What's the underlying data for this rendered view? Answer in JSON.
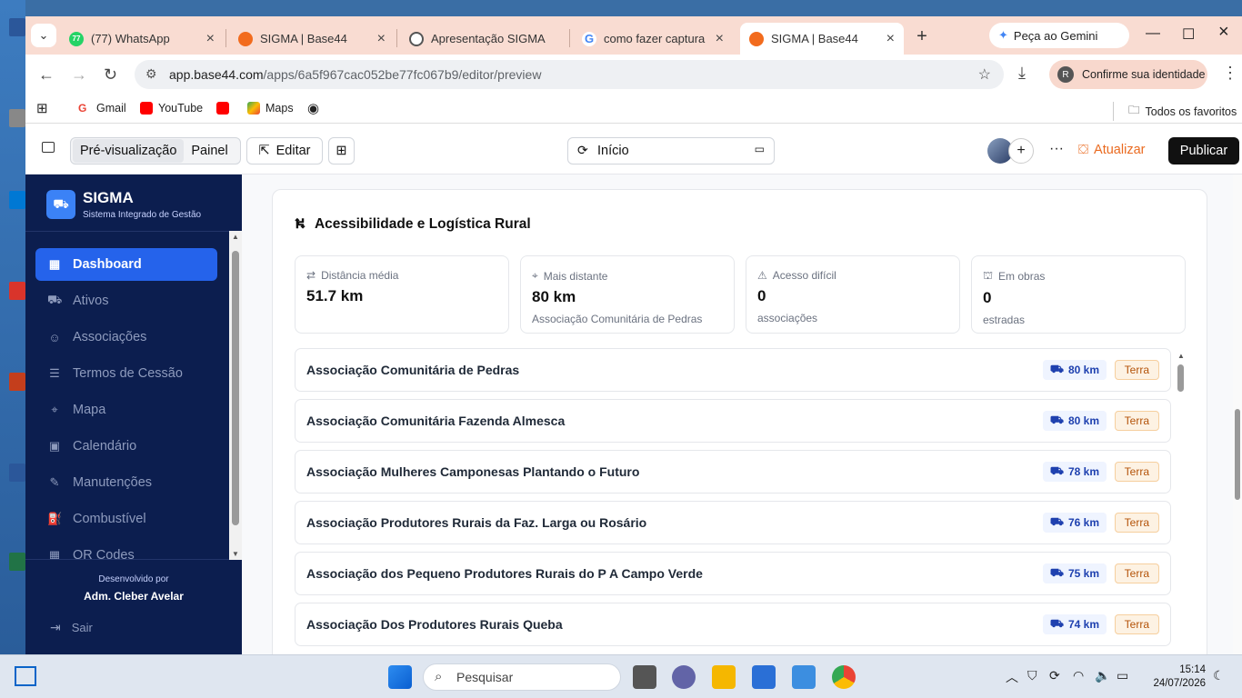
{
  "browser": {
    "tabs": [
      {
        "title": "(77) WhatsApp",
        "fav_color": "#25d366",
        "fav_text": "77"
      },
      {
        "title": "SIGMA | Base44",
        "fav_color": "#f26b1d",
        "fav_text": ""
      },
      {
        "title": "Apresentação SIGMA",
        "fav_color": "#555555",
        "fav_text": ""
      },
      {
        "title": "como fazer captura de",
        "fav_color": "#4285f4",
        "fav_text": "G"
      },
      {
        "title": "SIGMA | Base44",
        "fav_color": "#f26b1d",
        "fav_text": ""
      }
    ],
    "gemini_label": "Peça ao Gemini",
    "url_host": "app.base44.com",
    "url_path": "/apps/6a5f967cac052be77fc067b9/editor/preview",
    "confirm_label": "Confirme sua identidade",
    "bookmarks": [
      "Gmail",
      "YouTube",
      "Maps"
    ],
    "all_favorites": "Todos os favoritos"
  },
  "editor": {
    "preview_label": "Pré-visualização",
    "panel_label": "Painel",
    "edit_label": "Editar",
    "route_label": "Início",
    "update_label": "Atualizar",
    "publish_label": "Publicar"
  },
  "sidebar": {
    "app_name": "SIGMA",
    "app_sub": "Sistema Integrado de Gestão",
    "items": [
      {
        "label": "Dashboard",
        "icon": "▦"
      },
      {
        "label": "Ativos",
        "icon": "⛟"
      },
      {
        "label": "Associações",
        "icon": "☺"
      },
      {
        "label": "Termos de Cessão",
        "icon": "☰"
      },
      {
        "label": "Mapa",
        "icon": "⌖"
      },
      {
        "label": "Calendário",
        "icon": "▣"
      },
      {
        "label": "Manutenções",
        "icon": "✎"
      },
      {
        "label": "Combustível",
        "icon": "⛽"
      },
      {
        "label": "QR Codes",
        "icon": "▦"
      }
    ],
    "dev_label": "Desenvolvido por",
    "dev_name": "Adm. Cleber Avelar",
    "logout": "Sair"
  },
  "section": {
    "title": "Acessibilidade e Logística Rural",
    "stats": [
      {
        "label": "Distância média",
        "value": "51.7 km",
        "sub": ""
      },
      {
        "label": "Mais distante",
        "value": "80 km",
        "sub": "Associação Comunitária de Pedras"
      },
      {
        "label": "Acesso difícil",
        "value": "0",
        "sub": "associações"
      },
      {
        "label": "Em obras",
        "value": "0",
        "sub": "estradas"
      }
    ],
    "rows": [
      {
        "name": "Associação Comunitária de Pedras",
        "km": "80 km",
        "tag": "Terra"
      },
      {
        "name": "Associação Comunitária Fazenda Almesca",
        "km": "80 km",
        "tag": "Terra"
      },
      {
        "name": "Associação Mulheres Camponesas Plantando o Futuro",
        "km": "78 km",
        "tag": "Terra"
      },
      {
        "name": "Associação Produtores Rurais da Faz. Larga ou Rosário",
        "km": "76 km",
        "tag": "Terra"
      },
      {
        "name": "Associação dos Pequeno Produtores Rurais do P A Campo Verde",
        "km": "75 km",
        "tag": "Terra"
      },
      {
        "name": "Associação Dos Produtores Rurais Queba",
        "km": "74 km",
        "tag": "Terra"
      }
    ]
  },
  "taskbar": {
    "search_placeholder": "Pesquisar",
    "time": "15:14",
    "date": "24/07/2026"
  }
}
